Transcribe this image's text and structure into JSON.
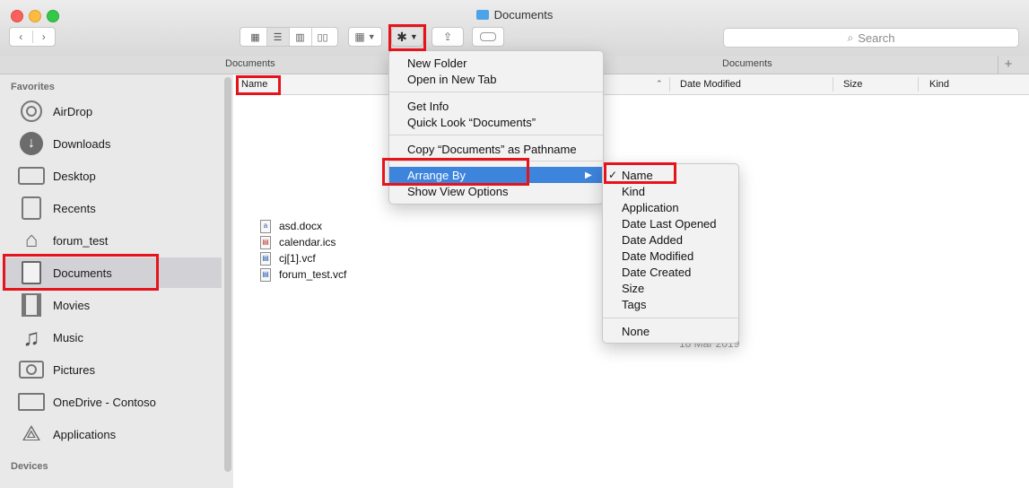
{
  "window": {
    "title": "Documents"
  },
  "toolbar": {
    "view_icons": [
      "icon-view-icon",
      "list-view-icon",
      "column-view-icon",
      "gallery-view-icon"
    ],
    "search_placeholder": "Search",
    "search_icon_glyph": "⌕"
  },
  "pathbar": {
    "left": "Documents",
    "right": "Documents"
  },
  "sidebar": {
    "favorites_header": "Favorites",
    "devices_header": "Devices",
    "items": [
      {
        "label": "AirDrop",
        "icon": "airdrop-icon"
      },
      {
        "label": "Downloads",
        "icon": "downloads-icon"
      },
      {
        "label": "Desktop",
        "icon": "desktop-icon"
      },
      {
        "label": "Recents",
        "icon": "recents-icon"
      },
      {
        "label": "forum_test",
        "icon": "home-icon"
      },
      {
        "label": "Documents",
        "icon": "documents-icon",
        "selected": true
      },
      {
        "label": "Movies",
        "icon": "movies-icon"
      },
      {
        "label": "Music",
        "icon": "music-icon"
      },
      {
        "label": "Pictures",
        "icon": "pictures-icon"
      },
      {
        "label": "OneDrive - Contoso",
        "icon": "folder-icon"
      },
      {
        "label": "Applications",
        "icon": "applications-icon"
      }
    ]
  },
  "list": {
    "columns": {
      "name": "Name",
      "date_modified": "Date Modified",
      "size": "Size",
      "kind": "Kind"
    },
    "files": [
      {
        "name": "asd.docx",
        "icon": "docx-file-icon"
      },
      {
        "name": "calendar.ics",
        "icon": "ics-file-icon"
      },
      {
        "name": "cj[1].vcf",
        "icon": "vcf-file-icon"
      },
      {
        "name": "forum_test.vcf",
        "icon": "vcf-file-icon"
      }
    ],
    "visible_date_fragment": "18 Mar 2019"
  },
  "gear_menu": {
    "items": [
      "New Folder",
      "Open in New Tab",
      "Get Info",
      "Quick Look “Documents”",
      "Copy “Documents” as Pathname",
      "Arrange By",
      "Show View Options"
    ],
    "highlighted": "Arrange By"
  },
  "arrange_submenu": {
    "items": [
      "Name",
      "Kind",
      "Application",
      "Date Last Opened",
      "Date Added",
      "Date Modified",
      "Date Created",
      "Size",
      "Tags",
      "None"
    ],
    "checked": "Name"
  },
  "colors": {
    "highlight": "#3d84dc",
    "annotation_red": "#e5141c",
    "folder_blue": "#4ea2e8"
  }
}
